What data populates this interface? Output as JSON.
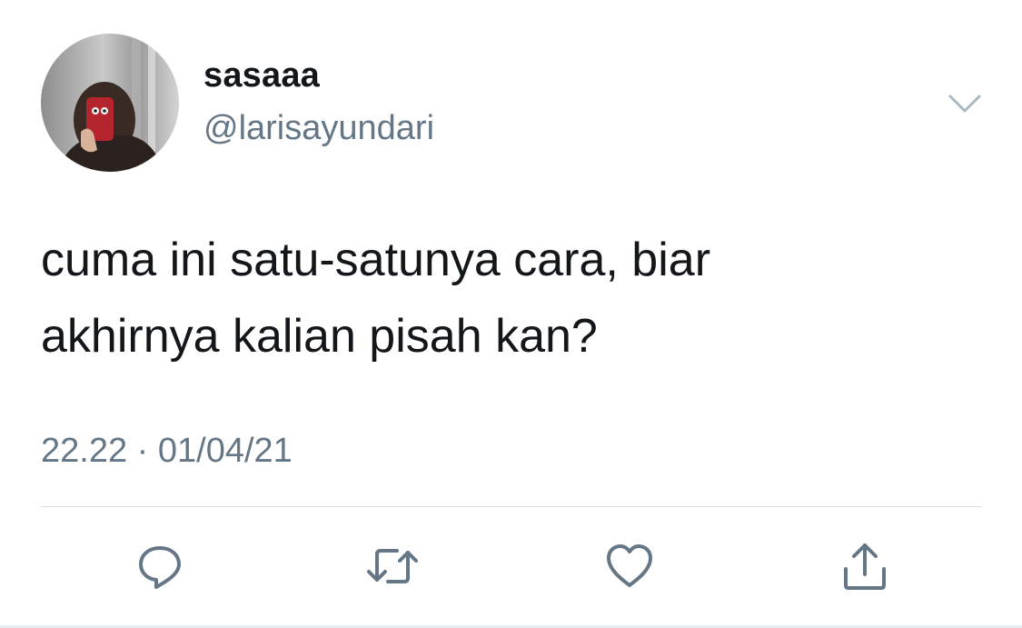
{
  "user": {
    "display_name": "sasaaa",
    "handle": "@larisayundari",
    "avatar_icon": "profile-photo"
  },
  "tweet": {
    "lines": [
      "cuma ini satu-satunya cara, biar",
      "akhirnya kalian pisah kan?"
    ],
    "time": "22.22",
    "separator": "·",
    "date": "01/04/21"
  },
  "actions": {
    "reply_icon": "reply-icon",
    "retweet_icon": "retweet-icon",
    "like_icon": "like-icon",
    "share_icon": "share-icon"
  },
  "colors": {
    "text": "#14171a",
    "secondary": "#657786",
    "icon": "#657786",
    "divider": "#d6dbe0"
  }
}
